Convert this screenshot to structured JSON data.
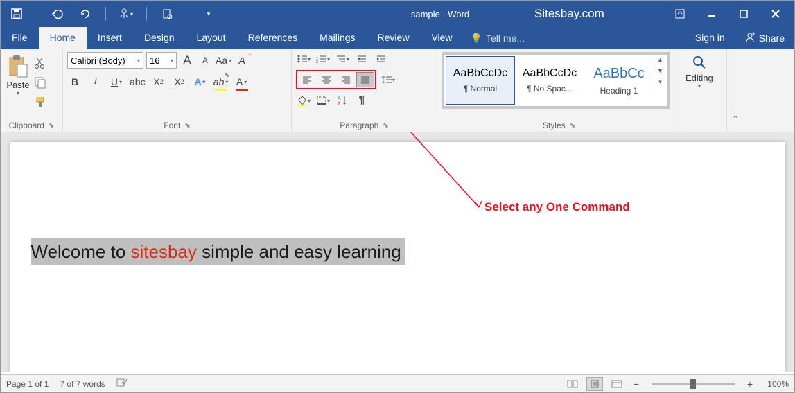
{
  "titlebar": {
    "doc_title": "sample - Word",
    "watermark": "Sitesbay.com"
  },
  "tabs": {
    "file": "File",
    "home": "Home",
    "insert": "Insert",
    "design": "Design",
    "layout": "Layout",
    "references": "References",
    "mailings": "Mailings",
    "review": "Review",
    "view": "View",
    "tellme": "Tell me...",
    "signin": "Sign in",
    "share": "Share"
  },
  "ribbon": {
    "clipboard": {
      "label": "Clipboard",
      "paste": "Paste"
    },
    "font": {
      "label": "Font",
      "name": "Calibri (Body)",
      "size": "16",
      "grow": "A",
      "shrink": "A",
      "case": "Aa",
      "clear": "A",
      "bold": "B",
      "italic": "I",
      "underline": "U",
      "strike": "abc",
      "sub": "X",
      "sup": "X",
      "texteffects": "A",
      "highlight": "ab",
      "fontcolor": "A"
    },
    "paragraph": {
      "label": "Paragraph"
    },
    "styles": {
      "label": "Styles",
      "preview": "AaBbCcDc",
      "preview_heading": "AaBbCc",
      "normal": "¶ Normal",
      "nospacing": "¶ No Spac...",
      "heading1": "Heading 1"
    },
    "editing": {
      "label": "Editing"
    }
  },
  "document": {
    "text_prefix": "Welcome to ",
    "text_highlight": "sitesbay",
    "text_suffix": " simple and easy learning"
  },
  "annotation": {
    "text": "Select any One Command"
  },
  "statusbar": {
    "page": "Page 1 of 1",
    "words": "7 of 7 words",
    "zoom": "100%"
  }
}
